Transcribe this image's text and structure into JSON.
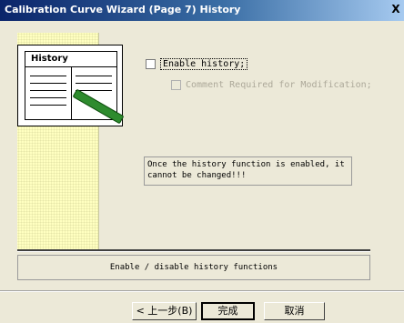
{
  "window": {
    "title": "Calibration Curve Wizard (Page 7) History",
    "close_glyph": "X"
  },
  "illustration": {
    "label": "History"
  },
  "options": {
    "enable_history": {
      "label": "Enable history;",
      "checked": false
    },
    "comment_required": {
      "label": "Comment Required for Modification;",
      "checked": false,
      "disabled": true
    }
  },
  "note": "Once the history function is enabled, it cannot be changed!!!",
  "status": "Enable / disable history functions",
  "buttons": {
    "back": "< 上一步(B)",
    "finish": "完成",
    "cancel": "取消"
  }
}
